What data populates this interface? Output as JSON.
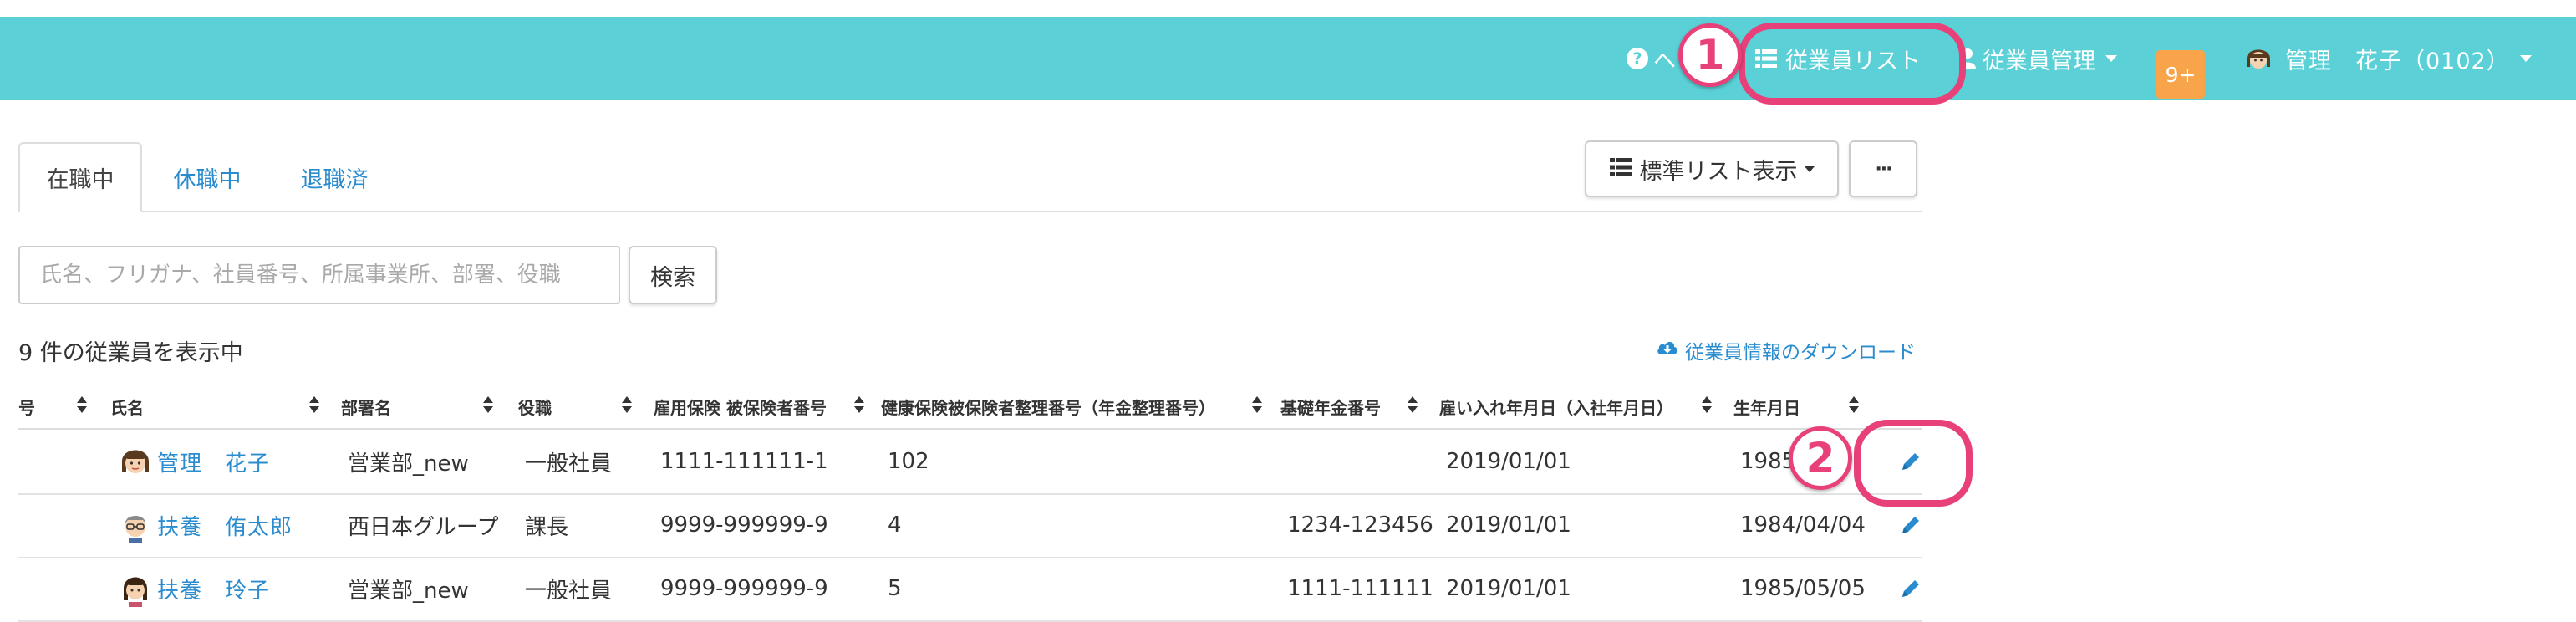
{
  "header": {
    "help_label": "ヘ",
    "employee_list_label": "従業員リスト",
    "employee_mgmt_label": "従業員管理",
    "notification_badge": "9+",
    "user_label": "管理　花子（0102）"
  },
  "tabs": [
    {
      "label": "在職中",
      "active": true
    },
    {
      "label": "休職中",
      "active": false
    },
    {
      "label": "退職済",
      "active": false
    }
  ],
  "toolbar": {
    "list_view_label": "標準リスト表示",
    "more_label": "···"
  },
  "search": {
    "placeholder": "氏名、フリガナ、社員番号、所属事業所、部署、役職",
    "button_label": "検索"
  },
  "summary": {
    "count_text": "9 件の従業員を表示中",
    "download_label": "従業員情報のダウンロード"
  },
  "table": {
    "columns": [
      "号",
      "氏名",
      "部署名",
      "役職",
      "雇用保険 被保険者番号",
      "健康保険被保険者整理番号（年金整理番号）",
      "基礎年金番号",
      "雇い入れ年月日（入社年月日）",
      "生年月日"
    ],
    "rows": [
      {
        "name": "管理　花子",
        "dept": "営業部_new",
        "title": "一般社員",
        "emp_ins": "1111-111111-1",
        "health_ins": "102",
        "pension": "",
        "hire_date": "2019/01/01",
        "birth": "1985/"
      },
      {
        "name": "扶養　侑太郎",
        "dept": "西日本グループ",
        "title": "課長",
        "emp_ins": "9999-999999-9",
        "health_ins": "4",
        "pension": "1234-123456",
        "hire_date": "2019/01/01",
        "birth": "1984/04/04"
      },
      {
        "name": "扶養　玲子",
        "dept": "営業部_new",
        "title": "一般社員",
        "emp_ins": "9999-999999-9",
        "health_ins": "5",
        "pension": "1111-111111",
        "hire_date": "2019/01/01",
        "birth": "1985/05/05"
      }
    ]
  },
  "callouts": [
    {
      "number": "1"
    },
    {
      "number": "2"
    }
  ],
  "colors": {
    "header_bg": "#5bd1d7",
    "link": "#2a8ccf",
    "badge": "#f7a44b",
    "callout": "#e8417a"
  }
}
